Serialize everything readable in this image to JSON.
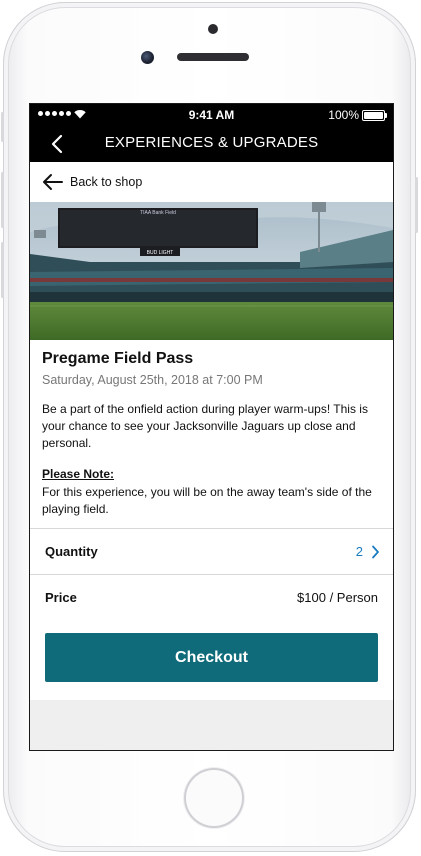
{
  "status_bar": {
    "time": "9:41 AM",
    "battery": "100%"
  },
  "nav": {
    "title": "EXPERIENCES & UPGRADES",
    "back_icon": "chevron-left-icon"
  },
  "back_link": {
    "label": "Back to shop",
    "icon": "arrow-left-icon"
  },
  "hero": {
    "scoreboard_text": "TIAA Bank Field",
    "banner_text": "BUD LIGHT"
  },
  "event": {
    "title": "Pregame Field Pass",
    "datetime": "Saturday, August 25th, 2018 at 7:00 PM",
    "description": "Be a part of the onfield action during player warm-ups! This is your chance to see your Jacksonville Jaguars up close and personal.",
    "note_label": "Please Note:",
    "note_text": "For this experience, you will be on the away team's side of the playing field."
  },
  "quantity": {
    "label": "Quantity",
    "value": "2"
  },
  "price": {
    "label": "Price",
    "value": "$100 / Person"
  },
  "checkout": {
    "label": "Checkout"
  },
  "colors": {
    "accent": "#0f6b7a",
    "link": "#1a7bbf",
    "nav_bg": "#000000"
  }
}
